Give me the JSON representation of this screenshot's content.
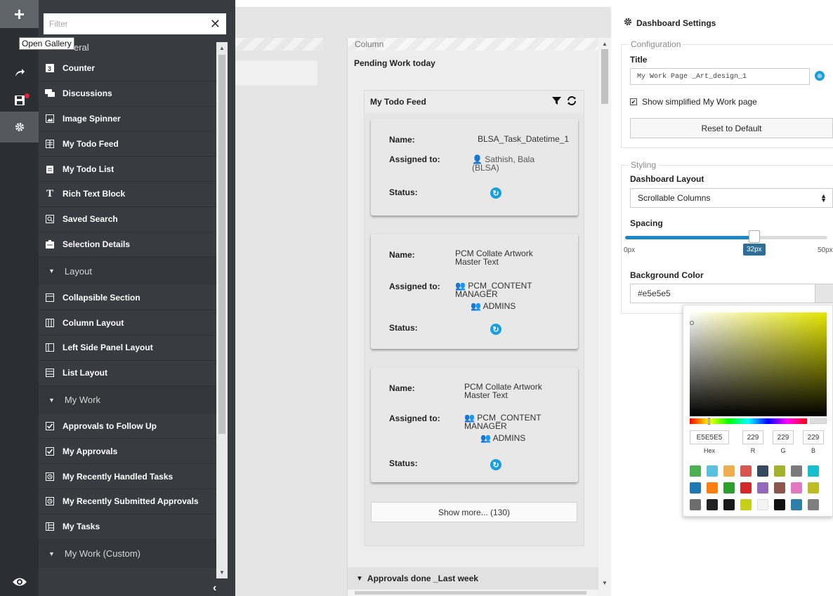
{
  "rail": {
    "add_icon": "plus-icon",
    "redo_icon": "redo-icon",
    "save_icon": "save-icon",
    "settings_icon": "gear-icon",
    "preview_icon": "eye-icon",
    "tooltip": "Open Gallery"
  },
  "gallery": {
    "filter_placeholder": "Filter",
    "top_category": "eral",
    "general_items": [
      {
        "label": "Counter",
        "icon": "counter-icon"
      },
      {
        "label": "Discussions",
        "icon": "chat-icon"
      },
      {
        "label": "Image Spinner",
        "icon": "image-icon"
      },
      {
        "label": "My Todo Feed",
        "icon": "feed-icon"
      },
      {
        "label": "My Todo List",
        "icon": "list-icon"
      },
      {
        "label": "Rich Text Block",
        "icon": "text-icon"
      },
      {
        "label": "Saved Search",
        "icon": "search-icon"
      },
      {
        "label": "Selection Details",
        "icon": "details-icon"
      }
    ],
    "layout_category": "Layout",
    "layout_items": [
      {
        "label": "Collapsible Section",
        "icon": "collapsible-icon"
      },
      {
        "label": "Column Layout",
        "icon": "column-icon"
      },
      {
        "label": "Left Side Panel Layout",
        "icon": "panel-icon"
      },
      {
        "label": "List Layout",
        "icon": "list-layout-icon"
      }
    ],
    "mywork_category": "My Work",
    "mywork_items": [
      {
        "label": "Approvals to Follow Up",
        "icon": "checkbox-icon"
      },
      {
        "label": "My Approvals",
        "icon": "checkbox-icon"
      },
      {
        "label": "My Recently Handled Tasks",
        "icon": "clock-icon"
      },
      {
        "label": "My Recently Submitted Approvals",
        "icon": "clock-icon"
      },
      {
        "label": "My Tasks",
        "icon": "tasks-icon"
      }
    ],
    "custom_category": "My Work (Custom)"
  },
  "canvas": {
    "column_header": "Column",
    "column_title": "Pending Work today",
    "feed_title": "My Todo Feed",
    "labels": {
      "name": "Name:",
      "assigned": "Assigned to:",
      "status": "Status:"
    },
    "cards": [
      {
        "name": "BLSA_Task_Datetime_1",
        "assigned": "Sathish, Bala (BLSA)"
      },
      {
        "name": "PCM Collate Artwork Master Text",
        "assigned": "PCM_CONTENT MANAGER",
        "group": "ADMINS"
      },
      {
        "name": "PCM Collate Artwork Master Text",
        "assigned": "PCM_CONTENT MANAGER",
        "group": "ADMINS"
      }
    ],
    "show_more": "Show more... (130)",
    "approvals_section": "Approvals done _Last week"
  },
  "settings": {
    "title": "Dashboard Settings",
    "configuration_legend": "Configuration",
    "title_label": "Title",
    "title_value": "My Work Page _Art_design_1",
    "simplified_label": "Show simplified My Work page",
    "simplified_checked": true,
    "reset_label": "Reset to Default",
    "styling_legend": "Styling",
    "layout_label": "Dashboard Layout",
    "layout_value": "Scrollable Columns",
    "spacing_label": "Spacing",
    "spacing_min": "0px",
    "spacing_max": "50px",
    "spacing_value": "32px",
    "spacing_fraction": 0.64,
    "bg_label": "Background Color",
    "bg_value": "#e5e5e5"
  },
  "picker": {
    "hex": "E5E5E5",
    "r": "229",
    "g": "229",
    "b": "229",
    "hex_label": "Hex",
    "r_label": "R",
    "g_label": "G",
    "b_label": "B",
    "swatches": [
      "#4caf50",
      "#5bc0de",
      "#f0ad4e",
      "#d9534f",
      "#34495e",
      "#a4b22b",
      "#7a7a7a",
      "#17becf",
      "#1f77b4",
      "#ff7f0e",
      "#2ca02c",
      "#d62728",
      "#9467bd",
      "#8c564b",
      "#e377c2",
      "#bcbd22",
      "#6d6d6d",
      "#222222",
      "#1a1a1a",
      "#c5d118",
      "#f4f4f4",
      "#111111",
      "#2c7fa8",
      "#7f7f7f"
    ]
  }
}
